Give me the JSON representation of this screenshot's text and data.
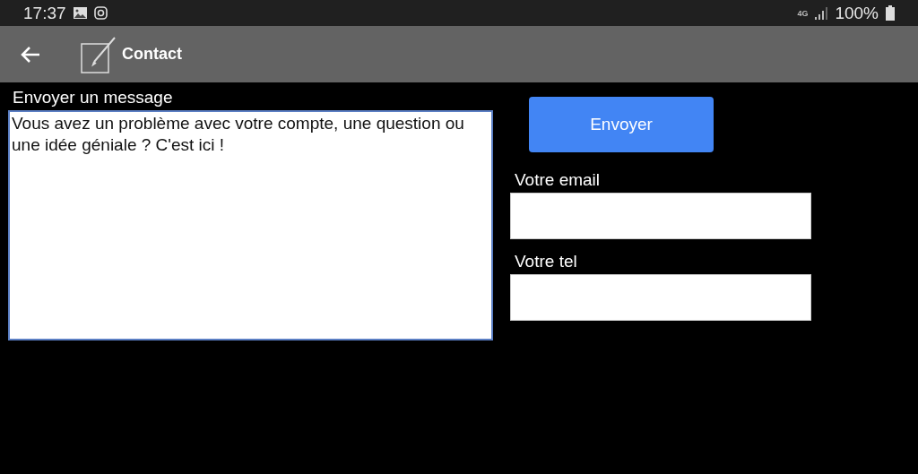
{
  "status_bar": {
    "time": "17:37",
    "network": "4G",
    "battery": "100%"
  },
  "toolbar": {
    "title": "Contact"
  },
  "message": {
    "label": "Envoyer un message",
    "placeholder": "Vous avez un problème avec votre compte, une question ou une idée géniale ? C'est ici !"
  },
  "send_button": "Envoyer",
  "fields": [
    {
      "label": "Votre email"
    },
    {
      "label": "Votre tel"
    }
  ]
}
